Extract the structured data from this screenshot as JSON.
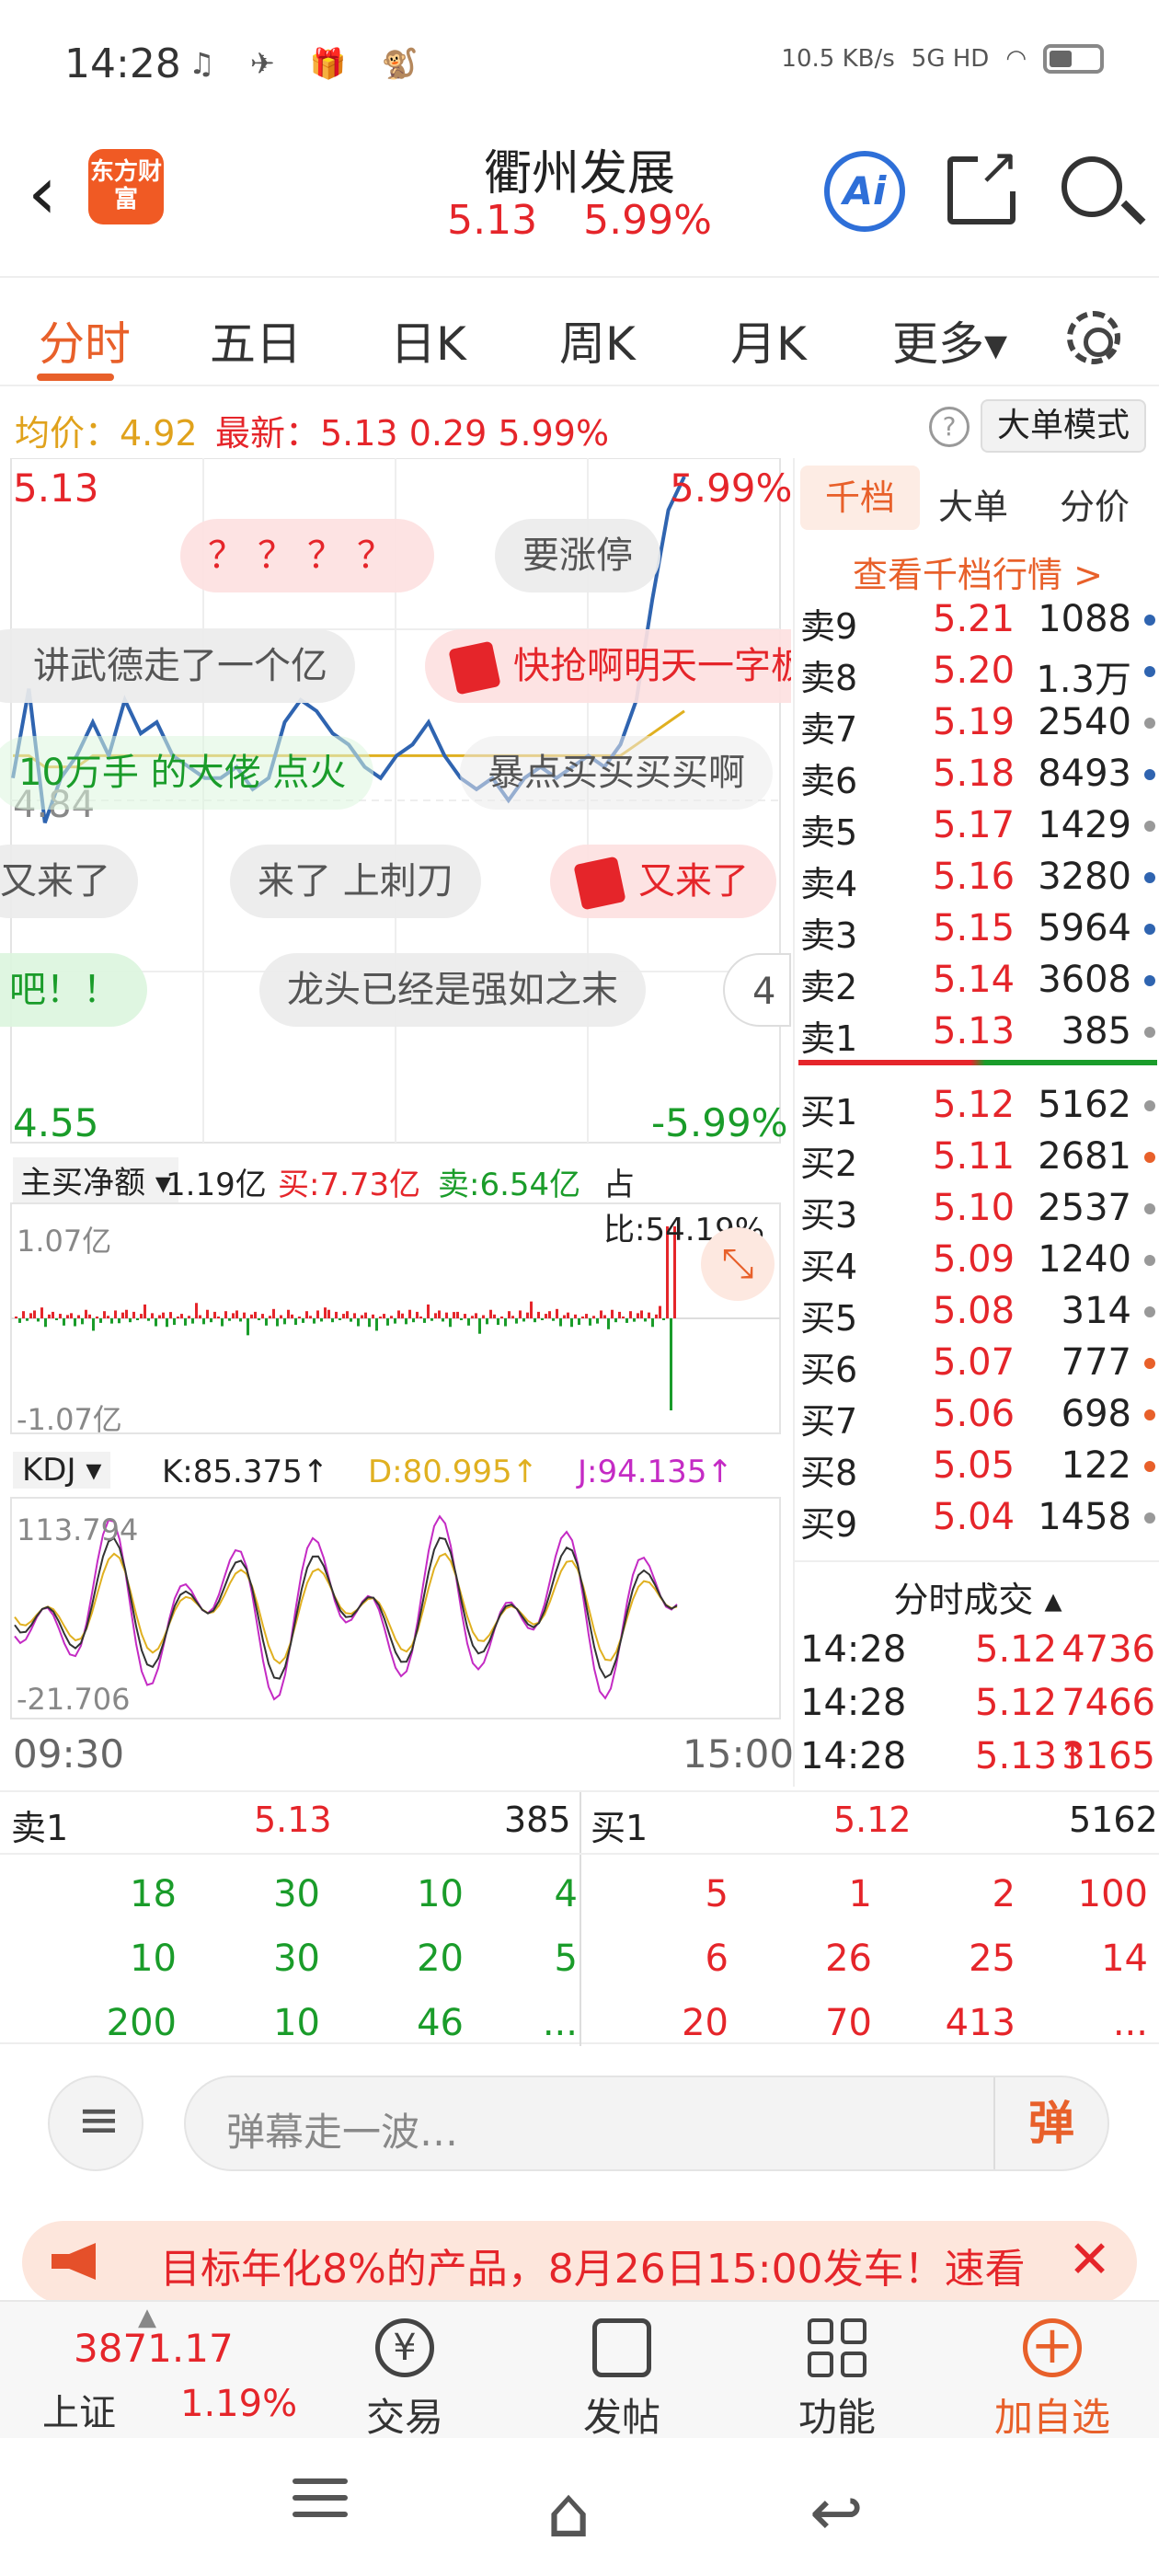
{
  "status_bar": {
    "time": "14:28",
    "app_icons": "♫ ✈ 🎁 🐒",
    "net_speed": "10.5 KB/s",
    "signal": "5G HD"
  },
  "header": {
    "logo_text": "东方财富",
    "stock_name": "衢州发展",
    "price": "5.13",
    "change_pct": "5.99%",
    "ai_label": "Ai"
  },
  "tabs": [
    "分时",
    "五日",
    "日K",
    "周K",
    "月K",
    "更多▾"
  ],
  "info_row": {
    "avg_label": "均价：4.92",
    "latest_label": "最新：5.13  0.29  5.99%",
    "help": "?",
    "big_order_mode": "大单模式"
  },
  "chart_data": {
    "type": "line",
    "x_start": "09:30",
    "x_end": "15:00",
    "y_top": "5.13",
    "y_mid": "4.84",
    "y_bottom": "4.55",
    "pct_top": "5.99%",
    "pct_bottom": "-5.99%",
    "price_series": [
      4.86,
      4.94,
      4.82,
      4.86,
      4.88,
      4.91,
      4.88,
      4.93,
      4.9,
      4.91,
      4.88,
      4.87,
      4.86,
      4.86,
      4.87,
      4.85,
      4.86,
      4.91,
      4.93,
      4.92,
      4.9,
      4.89,
      4.87,
      4.86,
      4.88,
      4.89,
      4.91,
      4.88,
      4.86,
      4.85,
      4.86,
      4.84,
      4.86,
      4.87,
      4.86,
      4.87,
      4.88,
      4.87,
      4.89,
      4.93,
      5.02,
      5.1,
      5.13
    ],
    "avg_series": [
      4.88,
      4.88,
      4.87,
      4.87,
      4.87,
      4.88,
      4.88,
      4.88,
      4.88,
      4.88,
      4.88,
      4.88,
      4.88,
      4.88,
      4.88,
      4.88,
      4.88,
      4.88,
      4.88,
      4.88,
      4.88,
      4.88,
      4.88,
      4.88,
      4.88,
      4.88,
      4.88,
      4.88,
      4.88,
      4.88,
      4.88,
      4.88,
      4.88,
      4.88,
      4.88,
      4.88,
      4.88,
      4.88,
      4.88,
      4.89,
      4.9,
      4.91,
      4.92
    ],
    "net_flow": {
      "label": "主买净额",
      "value": "1.19亿",
      "buy": "买:7.73亿",
      "sell": "卖:6.54亿",
      "ratio": "占比:54.19%",
      "y_max": "1.07亿",
      "y_min": "-1.07亿"
    },
    "kdj": {
      "label": "KDJ",
      "k": "K:85.375↑",
      "d": "D:80.995↑",
      "j": "J:94.135↑",
      "y_max": "113.794",
      "y_min": "-21.706"
    },
    "colors": {
      "price": "#2f64b0",
      "avg": "#e0b020",
      "up": "#e5252a",
      "down": "#1a9c2a",
      "k": "#333333",
      "d": "#e0b020",
      "j": "#c42bc4"
    }
  },
  "danmu": [
    {
      "text": "？？？？",
      "style": "pink"
    },
    {
      "text": "要涨停",
      "style": "gray"
    },
    {
      "text": "讲武德走了一个亿",
      "style": "gray"
    },
    {
      "text": "快抢啊明天一字板",
      "style": "pink"
    },
    {
      "text": "10万手 的大佬 点火",
      "style": "green"
    },
    {
      "text": "暴点买买买买啊",
      "style": "gray"
    },
    {
      "text": "又来了",
      "style": "gray"
    },
    {
      "text": "来了 上刺刀",
      "style": "gray"
    },
    {
      "text": "又来了",
      "style": "pink"
    },
    {
      "text": "吧！！",
      "style": "green"
    },
    {
      "text": "龙头已经是强如之末",
      "style": "gray"
    },
    {
      "text": "4",
      "style": "gray"
    }
  ],
  "order_book": {
    "tabs": [
      "千档",
      "大单",
      "分价"
    ],
    "link": "查看千档行情 >",
    "asks": [
      {
        "level": "卖9",
        "price": "5.21",
        "vol": "1088",
        "dot": "#2f64b0"
      },
      {
        "level": "卖8",
        "price": "5.20",
        "vol": "1.3万",
        "dot": "#2f64b0"
      },
      {
        "level": "卖7",
        "price": "5.19",
        "vol": "2540",
        "dot": "#999999"
      },
      {
        "level": "卖6",
        "price": "5.18",
        "vol": "8493",
        "dot": "#2f64b0"
      },
      {
        "level": "卖5",
        "price": "5.17",
        "vol": "1429",
        "dot": "#999999"
      },
      {
        "level": "卖4",
        "price": "5.16",
        "vol": "3280",
        "dot": "#2f64b0"
      },
      {
        "level": "卖3",
        "price": "5.15",
        "vol": "5964",
        "dot": "#2f64b0"
      },
      {
        "level": "卖2",
        "price": "5.14",
        "vol": "3608",
        "dot": "#2f64b0"
      },
      {
        "level": "卖1",
        "price": "5.13",
        "vol": "385",
        "dot": "#999999"
      }
    ],
    "bids": [
      {
        "level": "买1",
        "price": "5.12",
        "vol": "5162",
        "dot": "#999999"
      },
      {
        "level": "买2",
        "price": "5.11",
        "vol": "2681",
        "dot": "#e8602a"
      },
      {
        "level": "买3",
        "price": "5.10",
        "vol": "2537",
        "dot": "#999999"
      },
      {
        "level": "买4",
        "price": "5.09",
        "vol": "1240",
        "dot": "#999999"
      },
      {
        "level": "买5",
        "price": "5.08",
        "vol": "314",
        "dot": "#999999"
      },
      {
        "level": "买6",
        "price": "5.07",
        "vol": "777",
        "dot": "#e8602a"
      },
      {
        "level": "买7",
        "price": "5.06",
        "vol": "698",
        "dot": "#e8602a"
      },
      {
        "level": "买8",
        "price": "5.05",
        "vol": "122",
        "dot": "#e8602a"
      },
      {
        "level": "买9",
        "price": "5.04",
        "vol": "1458",
        "dot": "#999999"
      }
    ],
    "trades_title": "分时成交 ▴",
    "trades": [
      {
        "time": "14:28",
        "price": "5.12",
        "vol": "4736"
      },
      {
        "time": "14:28",
        "price": "5.12",
        "vol": "7466"
      },
      {
        "time": "14:28",
        "price": "5.13↑",
        "vol": "3165"
      }
    ]
  },
  "queue": {
    "sell_label": "卖1",
    "sell_price": "5.13",
    "sell_vol": "385",
    "buy_label": "买1",
    "buy_price": "5.12",
    "buy_vol": "5162",
    "sell_cells": [
      [
        "18",
        "30",
        "10",
        "4"
      ],
      [
        "10",
        "30",
        "20",
        "5"
      ],
      [
        "200",
        "10",
        "46",
        "..."
      ]
    ],
    "buy_cells": [
      [
        "5",
        "1",
        "2",
        "100"
      ],
      [
        "6",
        "26",
        "25",
        "14"
      ],
      [
        "20",
        "70",
        "413",
        "..."
      ]
    ]
  },
  "danmu_input": {
    "placeholder": "弹幕走一波…",
    "button": "弹"
  },
  "promo": {
    "text": "目标年化8%的产品，8月26日15:00发车！速看"
  },
  "bottom_nav": {
    "index_value": "3871.17",
    "index_name": "上证",
    "index_pct": "1.19%",
    "items": [
      "交易",
      "发帖",
      "功能",
      "加自选"
    ]
  }
}
